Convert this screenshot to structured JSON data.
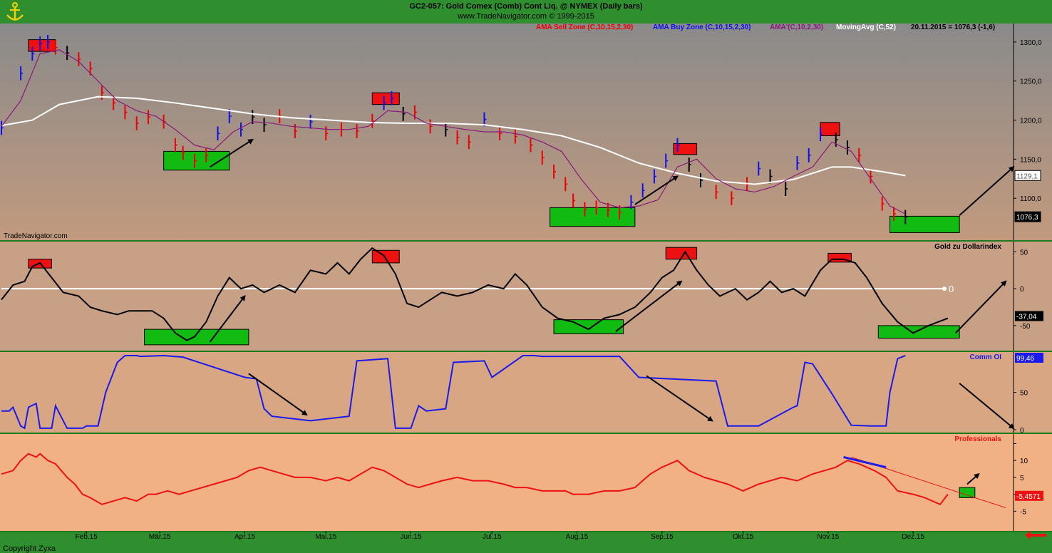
{
  "header": {
    "title": "GC2-057:  Gold Comex (Comb) Cont Liq. @ NYMEX  (Daily bars)",
    "subtitle": "www.TradeNavigator.com © 1999-2015"
  },
  "watermark": "TradeNavigator.com",
  "copyright": "Copyright Zyxa",
  "x_axis": {
    "labels": [
      "Feb.15",
      "Mär.15",
      "Apr.15",
      "Mai.15",
      "Jun.15",
      "Jul.15",
      "Aug.15",
      "Sep.15",
      "Okt.15",
      "Nov.15",
      "Dez.15"
    ],
    "days": [
      22,
      41,
      63,
      84,
      106,
      127,
      149,
      171,
      192,
      214,
      236
    ]
  },
  "colors": {
    "sell_zone": "#ee0000",
    "buy_zone": "#1010ee",
    "ama": "#8a1a7a",
    "moving_avg": "#ffffff",
    "neutral": "#000000",
    "zone_red": "#ee1111",
    "zone_green": "#11bb11",
    "comm_oi": "#1a1aee",
    "professionals": "#ee1111",
    "panel_divider": "#1e7a1e"
  },
  "chart_data": [
    {
      "type": "line",
      "title": "",
      "legend": [
        {
          "label": "AMA Sell Zone (C,10,15,2,30)",
          "color": "#ee0000"
        },
        {
          "label": "AMA Buy Zone (C,10,15,2,30)",
          "color": "#1010ee"
        },
        {
          "label": "AMA'(C,10,2,30)",
          "color": "#8a1a7a"
        },
        {
          "label": "MovingAvg (C,52)",
          "color": "#ffffff"
        },
        {
          "label": "20.11.2015 = 1076,3 (-1,6)",
          "color": "#000000"
        }
      ],
      "ylim": [
        1050,
        1320
      ],
      "yticks": [
        1100,
        1150,
        1200,
        1250,
        1300
      ],
      "ytick_labels": [
        "1100,0",
        "1150,0",
        "1200,0",
        "1250,0",
        "1300,0"
      ],
      "value_labels": [
        {
          "text": "1129,1",
          "value": 1129.1
        },
        {
          "text": "1076,3",
          "value": 1076.3
        }
      ],
      "bars": {
        "days": [
          0,
          5,
          8,
          10,
          12,
          14,
          17,
          20,
          23,
          26,
          29,
          32,
          35,
          38,
          42,
          45,
          47,
          50,
          53,
          56,
          59,
          62,
          65,
          68,
          72,
          76,
          80,
          84,
          88,
          92,
          96,
          99,
          101,
          104,
          107,
          111,
          115,
          118,
          121,
          125,
          129,
          133,
          137,
          140,
          143,
          146,
          148,
          151,
          154,
          157,
          160,
          163,
          166,
          169,
          172,
          175,
          178,
          181,
          185,
          189,
          193,
          196,
          199,
          203,
          206,
          209,
          212,
          216,
          219,
          222,
          225,
          228,
          231,
          234
        ],
        "close": [
          1190,
          1260,
          1285,
          1298,
          1300,
          1293,
          1286,
          1278,
          1266,
          1235,
          1222,
          1210,
          1196,
          1204,
          1198,
          1168,
          1158,
          1148,
          1155,
          1183,
          1205,
          1188,
          1204,
          1194,
          1205,
          1186,
          1198,
          1183,
          1188,
          1186,
          1199,
          1222,
          1228,
          1208,
          1210,
          1192,
          1188,
          1178,
          1172,
          1201,
          1183,
          1179,
          1168,
          1152,
          1134,
          1118,
          1097,
          1086,
          1088,
          1085,
          1082,
          1095,
          1110,
          1128,
          1148,
          1168,
          1143,
          1123,
          1108,
          1100,
          1118,
          1138,
          1128,
          1112,
          1145,
          1155,
          1182,
          1175,
          1165,
          1155,
          1128,
          1093,
          1080,
          1076
        ],
        "signal": [
          "b",
          "b",
          "b",
          "b",
          "b",
          "r",
          "k",
          "r",
          "r",
          "r",
          "r",
          "r",
          "r",
          "r",
          "r",
          "r",
          "r",
          "r",
          "r",
          "b",
          "b",
          "b",
          "k",
          "k",
          "r",
          "r",
          "b",
          "r",
          "r",
          "r",
          "r",
          "b",
          "b",
          "k",
          "r",
          "r",
          "k",
          "r",
          "r",
          "b",
          "r",
          "r",
          "r",
          "r",
          "r",
          "r",
          "r",
          "r",
          "r",
          "r",
          "r",
          "b",
          "b",
          "b",
          "b",
          "b",
          "k",
          "k",
          "r",
          "r",
          "r",
          "b",
          "k",
          "k",
          "b",
          "b",
          "b",
          "k",
          "k",
          "r",
          "r",
          "r",
          "r",
          "k"
        ]
      },
      "ama_line": {
        "days": [
          0,
          5,
          10,
          15,
          20,
          25,
          30,
          35,
          40,
          45,
          50,
          55,
          60,
          65,
          70,
          75,
          80,
          85,
          90,
          95,
          100,
          105,
          110,
          115,
          120,
          125,
          130,
          135,
          140,
          145,
          150,
          155,
          160,
          165,
          170,
          175,
          180,
          185,
          190,
          195,
          200,
          205,
          210,
          215,
          220,
          225,
          230,
          234
        ],
        "values": [
          1192,
          1225,
          1285,
          1290,
          1275,
          1250,
          1225,
          1212,
          1205,
          1188,
          1168,
          1162,
          1185,
          1198,
          1196,
          1192,
          1190,
          1188,
          1188,
          1192,
          1212,
          1210,
          1196,
          1192,
          1188,
          1185,
          1185,
          1181,
          1172,
          1160,
          1125,
          1095,
          1088,
          1090,
          1098,
          1140,
          1150,
          1125,
          1112,
          1108,
          1115,
          1128,
          1140,
          1172,
          1160,
          1125,
          1090,
          1080
        ]
      },
      "moving_avg": {
        "days": [
          0,
          8,
          15,
          25,
          35,
          45,
          55,
          65,
          75,
          85,
          95,
          105,
          115,
          125,
          135,
          145,
          155,
          165,
          175,
          185,
          195,
          205,
          215,
          220,
          228,
          234
        ],
        "values": [
          1193,
          1200,
          1220,
          1230,
          1228,
          1222,
          1215,
          1208,
          1203,
          1200,
          1197,
          1196,
          1196,
          1194,
          1188,
          1180,
          1165,
          1145,
          1132,
          1122,
          1118,
          1124,
          1140,
          1140,
          1134,
          1129
        ]
      },
      "zones": [
        {
          "color": "red",
          "day1": 7,
          "day2": 14,
          "value1": 1303,
          "value2": 1288
        },
        {
          "color": "green",
          "day1": 42,
          "day2": 59,
          "value1": 1160,
          "value2": 1136
        },
        {
          "color": "red",
          "day1": 96,
          "day2": 103,
          "value1": 1235,
          "value2": 1220
        },
        {
          "color": "red",
          "day1": 174,
          "day2": 180,
          "value1": 1170,
          "value2": 1156
        },
        {
          "color": "green",
          "day1": 142,
          "day2": 164,
          "value1": 1088,
          "value2": 1064
        },
        {
          "color": "red",
          "day1": 212,
          "day2": 217,
          "value1": 1197,
          "value2": 1180
        },
        {
          "color": "green",
          "day1": 230,
          "day2": 248,
          "value1": 1077,
          "value2": 1056
        }
      ],
      "arrows": [
        {
          "day1": 54,
          "value1": 1140,
          "day2": 65,
          "value2": 1175
        },
        {
          "day1": 164,
          "value1": 1092,
          "day2": 175,
          "value2": 1128
        },
        {
          "day1": 248,
          "value1": 1078,
          "day2": 262,
          "value2": 1140
        }
      ]
    },
    {
      "type": "line",
      "title": "Gold zu Dollarindex",
      "ylim": [
        -80,
        60
      ],
      "yticks": [
        -50,
        0,
        50
      ],
      "ytick_labels": [
        "-50",
        "0",
        "50"
      ],
      "value_label": {
        "text": "-37,04",
        "value": -37.04
      },
      "zero_label": "0",
      "days": [
        0,
        3,
        6,
        8,
        10,
        13,
        16,
        20,
        23,
        26,
        30,
        33,
        36,
        39,
        42,
        45,
        48,
        50,
        53,
        56,
        59,
        62,
        65,
        68,
        72,
        76,
        80,
        84,
        87,
        90,
        93,
        96,
        99,
        102,
        105,
        108,
        111,
        114,
        118,
        122,
        126,
        130,
        133,
        136,
        140,
        144,
        148,
        152,
        156,
        160,
        164,
        168,
        171,
        174,
        177,
        180,
        183,
        186,
        190,
        193,
        196,
        199,
        202,
        205,
        208,
        212,
        215,
        218,
        221,
        224,
        228,
        232,
        236,
        240,
        245
      ],
      "values": [
        -15,
        5,
        10,
        30,
        35,
        15,
        -5,
        -10,
        -25,
        -30,
        -35,
        -30,
        -30,
        -30,
        -40,
        -60,
        -70,
        -65,
        -45,
        -10,
        15,
        0,
        5,
        -5,
        5,
        -5,
        25,
        20,
        35,
        20,
        40,
        55,
        45,
        20,
        -20,
        -25,
        -15,
        -5,
        -10,
        -5,
        5,
        0,
        20,
        5,
        -25,
        -40,
        -45,
        -55,
        -40,
        -35,
        -25,
        -5,
        15,
        25,
        50,
        25,
        5,
        -10,
        0,
        -15,
        -5,
        10,
        -5,
        0,
        -10,
        25,
        40,
        40,
        35,
        15,
        -20,
        -45,
        -60,
        -50,
        -40,
        -37
      ],
      "zones": [
        {
          "color": "red",
          "day1": 7,
          "day2": 13,
          "value1": 40,
          "value2": 28
        },
        {
          "color": "green",
          "day1": 37,
          "day2": 64,
          "value1": -55,
          "value2": -76
        },
        {
          "color": "red",
          "day1": 96,
          "day2": 103,
          "value1": 52,
          "value2": 35
        },
        {
          "color": "green",
          "day1": 143,
          "day2": 161,
          "value1": -42,
          "value2": -61
        },
        {
          "color": "red",
          "day1": 172,
          "day2": 180,
          "value1": 56,
          "value2": 40
        },
        {
          "color": "red",
          "day1": 214,
          "day2": 220,
          "value1": 48,
          "value2": 36
        },
        {
          "color": "green",
          "day1": 227,
          "day2": 248,
          "value1": -50,
          "value2": -67
        }
      ],
      "arrows": [
        {
          "day1": 54,
          "value1": -72,
          "day2": 63,
          "value2": -10
        },
        {
          "day1": 159,
          "value1": -58,
          "day2": 176,
          "value2": 10
        },
        {
          "day1": 247,
          "value1": -60,
          "day2": 260,
          "value2": 10
        }
      ]
    },
    {
      "type": "line",
      "title": "Comm OI",
      "ylim": [
        0,
        100
      ],
      "yticks": [
        0,
        50
      ],
      "ytick_labels": [
        "0",
        "50"
      ],
      "value_label": {
        "text": "99,46",
        "value": 99.46
      },
      "days": [
        0,
        2,
        3,
        5,
        6,
        7,
        9,
        10,
        13,
        14,
        17,
        18,
        21,
        22,
        25,
        27,
        30,
        32,
        35,
        36,
        42,
        47,
        63,
        66,
        68,
        70,
        75,
        80,
        85,
        90,
        92,
        100,
        102,
        106,
        108,
        110,
        115,
        117,
        125,
        127,
        135,
        138,
        140,
        160,
        165,
        185,
        188,
        192,
        196,
        205,
        206,
        208,
        210,
        215,
        220,
        225,
        229,
        230,
        232,
        234
      ],
      "values": [
        25,
        25,
        30,
        5,
        2,
        30,
        35,
        2,
        2,
        32,
        2,
        2,
        2,
        5,
        5,
        50,
        90,
        99,
        99,
        98,
        99,
        97,
        70,
        68,
        28,
        18,
        15,
        12,
        15,
        18,
        92,
        95,
        2,
        2,
        32,
        25,
        28,
        90,
        92,
        70,
        99,
        99,
        98,
        98,
        70,
        65,
        5,
        5,
        5,
        30,
        32,
        90,
        88,
        48,
        6,
        5,
        5,
        50,
        95,
        99
      ],
      "arrows": [
        {
          "day1": 64,
          "value1": 75,
          "day2": 79,
          "value2": 20
        },
        {
          "day1": 167,
          "value1": 72,
          "day2": 184,
          "value2": 12
        },
        {
          "day1": 248,
          "value1": 62,
          "day2": 262,
          "value2": 2
        }
      ]
    },
    {
      "type": "line",
      "title": "Professionals",
      "ylim": [
        -15,
        12
      ],
      "yticks": [
        -10,
        -5,
        0,
        5,
        10
      ],
      "ytick_labels": [
        "-5",
        "0",
        "5",
        "10"
      ],
      "value_label": {
        "text": "-5,4571",
        "value": -5.4571
      },
      "days": [
        0,
        3,
        5,
        7,
        9,
        10,
        12,
        14,
        17,
        19,
        21,
        23,
        26,
        29,
        32,
        35,
        38,
        40,
        43,
        46,
        49,
        52,
        55,
        58,
        61,
        64,
        67,
        70,
        73,
        76,
        80,
        84,
        87,
        90,
        93,
        96,
        99,
        102,
        105,
        108,
        111,
        114,
        118,
        122,
        126,
        130,
        133,
        136,
        140,
        143,
        146,
        148,
        152,
        156,
        160,
        164,
        168,
        171,
        175,
        178,
        182,
        185,
        188,
        192,
        196,
        199,
        202,
        206,
        210,
        213,
        216,
        219,
        222,
        226,
        229,
        232,
        236,
        239,
        243,
        245
      ],
      "values": [
        1,
        2,
        5,
        7,
        6,
        7,
        5,
        4,
        0,
        -2,
        -5,
        -6,
        -8,
        -7,
        -6,
        -7,
        -5,
        -5,
        -4,
        -5,
        -4,
        -3,
        -2,
        -1,
        0,
        2,
        3,
        2,
        1,
        0,
        0,
        -1,
        0,
        -1,
        1,
        3,
        2,
        0,
        -2,
        -3,
        -2,
        -1,
        0,
        -1,
        -1,
        -2,
        -3,
        -3,
        -4,
        -4,
        -4,
        -5,
        -5,
        -4,
        -4,
        -3,
        1,
        3,
        5,
        2,
        0,
        -1,
        -2,
        -4,
        -2,
        -1,
        0,
        -1,
        1,
        2,
        3,
        5,
        4,
        2,
        0,
        -4,
        -5,
        -6,
        -8,
        -5
      ],
      "zones": [
        {
          "color": "green",
          "day1": 248,
          "day2": 252,
          "value1": -3,
          "value2": -6
        }
      ],
      "arrows": [
        {
          "day1": 250,
          "value1": -2,
          "day2": 253,
          "value2": 1
        }
      ],
      "trendline": {
        "day1": 220,
        "value1": 6,
        "day2": 260,
        "value2": -9
      },
      "blue_segment": {
        "day1": 218,
        "value1": 6,
        "day2": 229,
        "value2": 3
      }
    }
  ]
}
